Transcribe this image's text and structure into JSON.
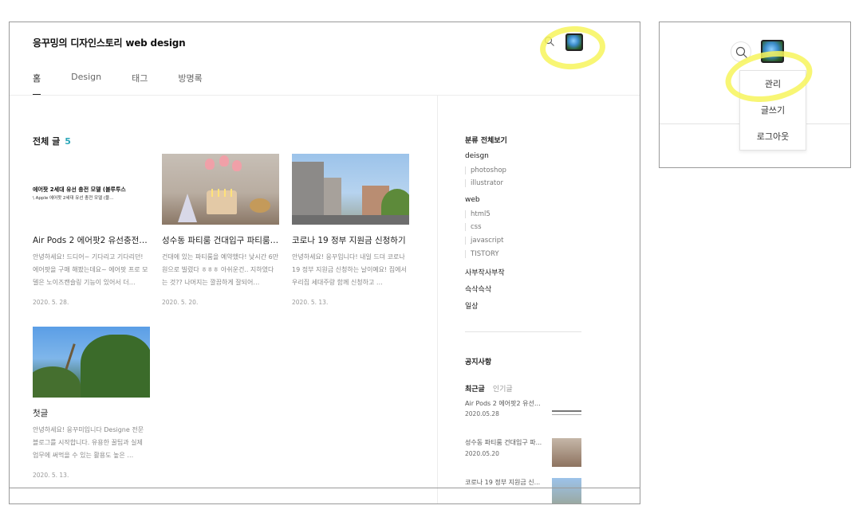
{
  "blog": {
    "title": "응꾸밍의 디자인스토리 web design",
    "nav": [
      "홈",
      "Design",
      "태그",
      "방명록"
    ],
    "post_count_label": "전체 글",
    "post_count": "5"
  },
  "posts": [
    {
      "title": "Air Pods 2 에어팟2 유선충전모...",
      "summary": "안녕하세요! 드디어~ 기다리고 기다리던! 에어팟을 구매 해봤는데요~ 에어팟 프로 모델은 노이즈캔슬링 기능이 있어서 더…",
      "date": "2020. 5. 28.",
      "thumb_line1": "에어팟 2세대 유선 충전 모델 (블루투스",
      "thumb_line2": "\\ Apple 에어팟 2세대 유선 충전 모델 (블…"
    },
    {
      "title": "성수동 파티룸 건대입구 파티룸 ...",
      "summary": "건대에 있는 파티룸을 예약했다! 낮시간 6만원으로 빌렸다 ㅎㅎㅎ 아쉬운건.. 지하였다는 것?? 나머지는 깔끔하게 잘되어…",
      "date": "2020. 5. 20."
    },
    {
      "title": "코로나 19 정부 지원금 신청하기",
      "summary": "안녕하세요! 응꾸입니다! 내일 드뎌 코로나19 정부 지원금 신청하는 날이예요! 집에서 우리집 세대주랑 함께 신청하고 …",
      "date": "2020. 5. 13."
    },
    {
      "title": "첫글",
      "summary": "안녕하세요! 응꾸미입니다 Designe 전문 블로그를 시작합니다. 유용한 꿀팁과 실제 업무에 써먹을 수 있는 활용도 높은 …",
      "date": "2020. 5. 13."
    }
  ],
  "sidebar": {
    "category_header": "분류 전체보기",
    "groups": [
      {
        "label": "deisgn",
        "children": [
          "photoshop",
          "illustrator"
        ]
      },
      {
        "label": "web",
        "children": [
          "html5",
          "css",
          "javascript",
          "TISTORY"
        ]
      },
      {
        "label": "사부작사부작",
        "children": []
      },
      {
        "label": "슥삭슥삭",
        "children": []
      },
      {
        "label": "일상",
        "children": []
      }
    ],
    "notice_header": "공지사항",
    "tabs": {
      "recent": "최근글",
      "popular": "인기글"
    },
    "recent_posts": [
      {
        "title": "Air Pods 2 에어팟2 유선충...",
        "date": "2020.05.28"
      },
      {
        "title": "성수동 파티룸 건대입구 파...",
        "date": "2020.05.20"
      },
      {
        "title": "코로나 19 정부 지원금 신...",
        "date": ""
      }
    ]
  },
  "dropdown": {
    "items": [
      "관리",
      "글쓰기",
      "로그아웃"
    ]
  },
  "icons": {
    "search": "search-icon",
    "avatar": "profile-avatar"
  },
  "colors": {
    "accent": "#2aa6b8",
    "highlight": "#f7f45c"
  }
}
